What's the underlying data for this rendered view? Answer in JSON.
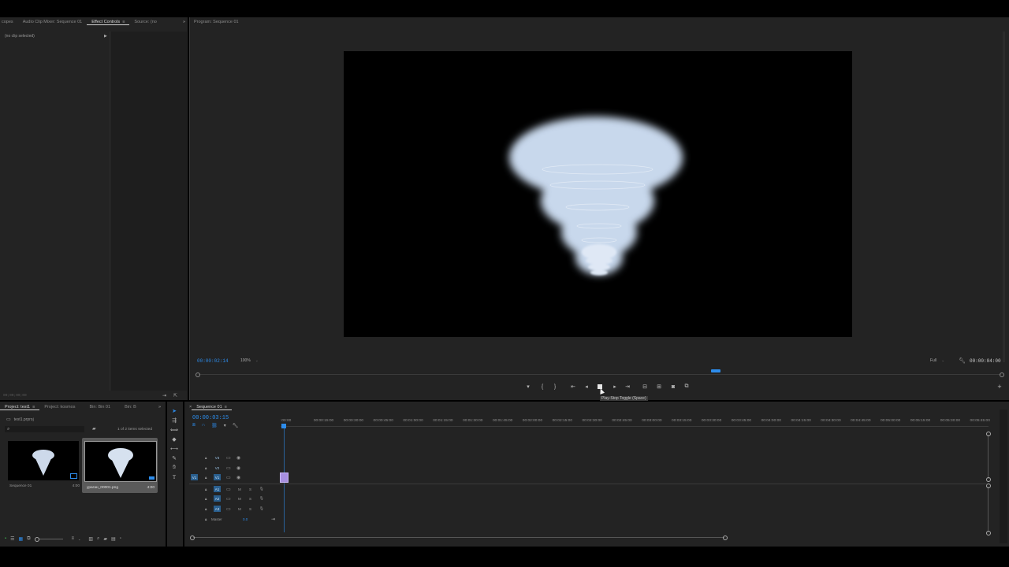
{
  "source_panel": {
    "tabs": [
      {
        "label": "copes"
      },
      {
        "label": "Audio Clip Mixer: Sequence 01"
      },
      {
        "label": "Effect Controls"
      },
      {
        "label": "Source: (no"
      }
    ],
    "no_clip_label": "(no clip selected)",
    "timecode": "00;00;00;00"
  },
  "program_monitor": {
    "title": "Program: Sequence 01",
    "current_timecode": "00:00:02:14",
    "zoom": "100%",
    "resolution": "Full",
    "duration": "00:00:04:00",
    "tooltip": "Play-Stop Toggle (Space)"
  },
  "project_panel": {
    "tabs": [
      {
        "label": "Project: test1"
      },
      {
        "label": "Project: kosmos"
      },
      {
        "label": "Bin: Bin 01"
      },
      {
        "label": "Bin: B"
      }
    ],
    "project_file": "test1.prproj",
    "selection_count": "1 of 2 items selected",
    "items": [
      {
        "name": "Sequence 01",
        "duration": "4:00"
      },
      {
        "name": "ураган_00001.png",
        "duration": "4:00"
      }
    ]
  },
  "timeline": {
    "tab": "Sequence 01",
    "timecode": "00:00:03:15",
    "ruler": [
      ":00:00",
      "00:00:15:00",
      "00:00:30:00",
      "00:00:45:00",
      "00:01:00:00",
      "00:01:15:00",
      "00:01:30:00",
      "00:01:45:00",
      "00:02:00:00",
      "00:02:15:00",
      "00:02:30:00",
      "00:02:45:00",
      "00:03:00:00",
      "00:03:15:00",
      "00:03:30:00",
      "00:03:45:00",
      "00:04:00:00",
      "00:04:15:00",
      "00:04:30:00",
      "00:04:45:00",
      "00:05:00:00",
      "00:05:15:00",
      "00:05:30:00",
      "00:05:45:00",
      "0"
    ],
    "video_tracks": [
      {
        "label": "V3"
      },
      {
        "label": "V2"
      },
      {
        "label": "V1",
        "source": "V1"
      }
    ],
    "audio_tracks": [
      {
        "label": "A1",
        "m": "M",
        "s": "S"
      },
      {
        "label": "A2",
        "m": "M",
        "s": "S"
      },
      {
        "label": "A3",
        "m": "M",
        "s": "S"
      }
    ],
    "master": {
      "label": "Master",
      "value": "0.0"
    }
  },
  "colors": {
    "accent_blue": "#2d8ceb",
    "clip_purple": "#a78fe0",
    "panel_bg": "#232323"
  }
}
